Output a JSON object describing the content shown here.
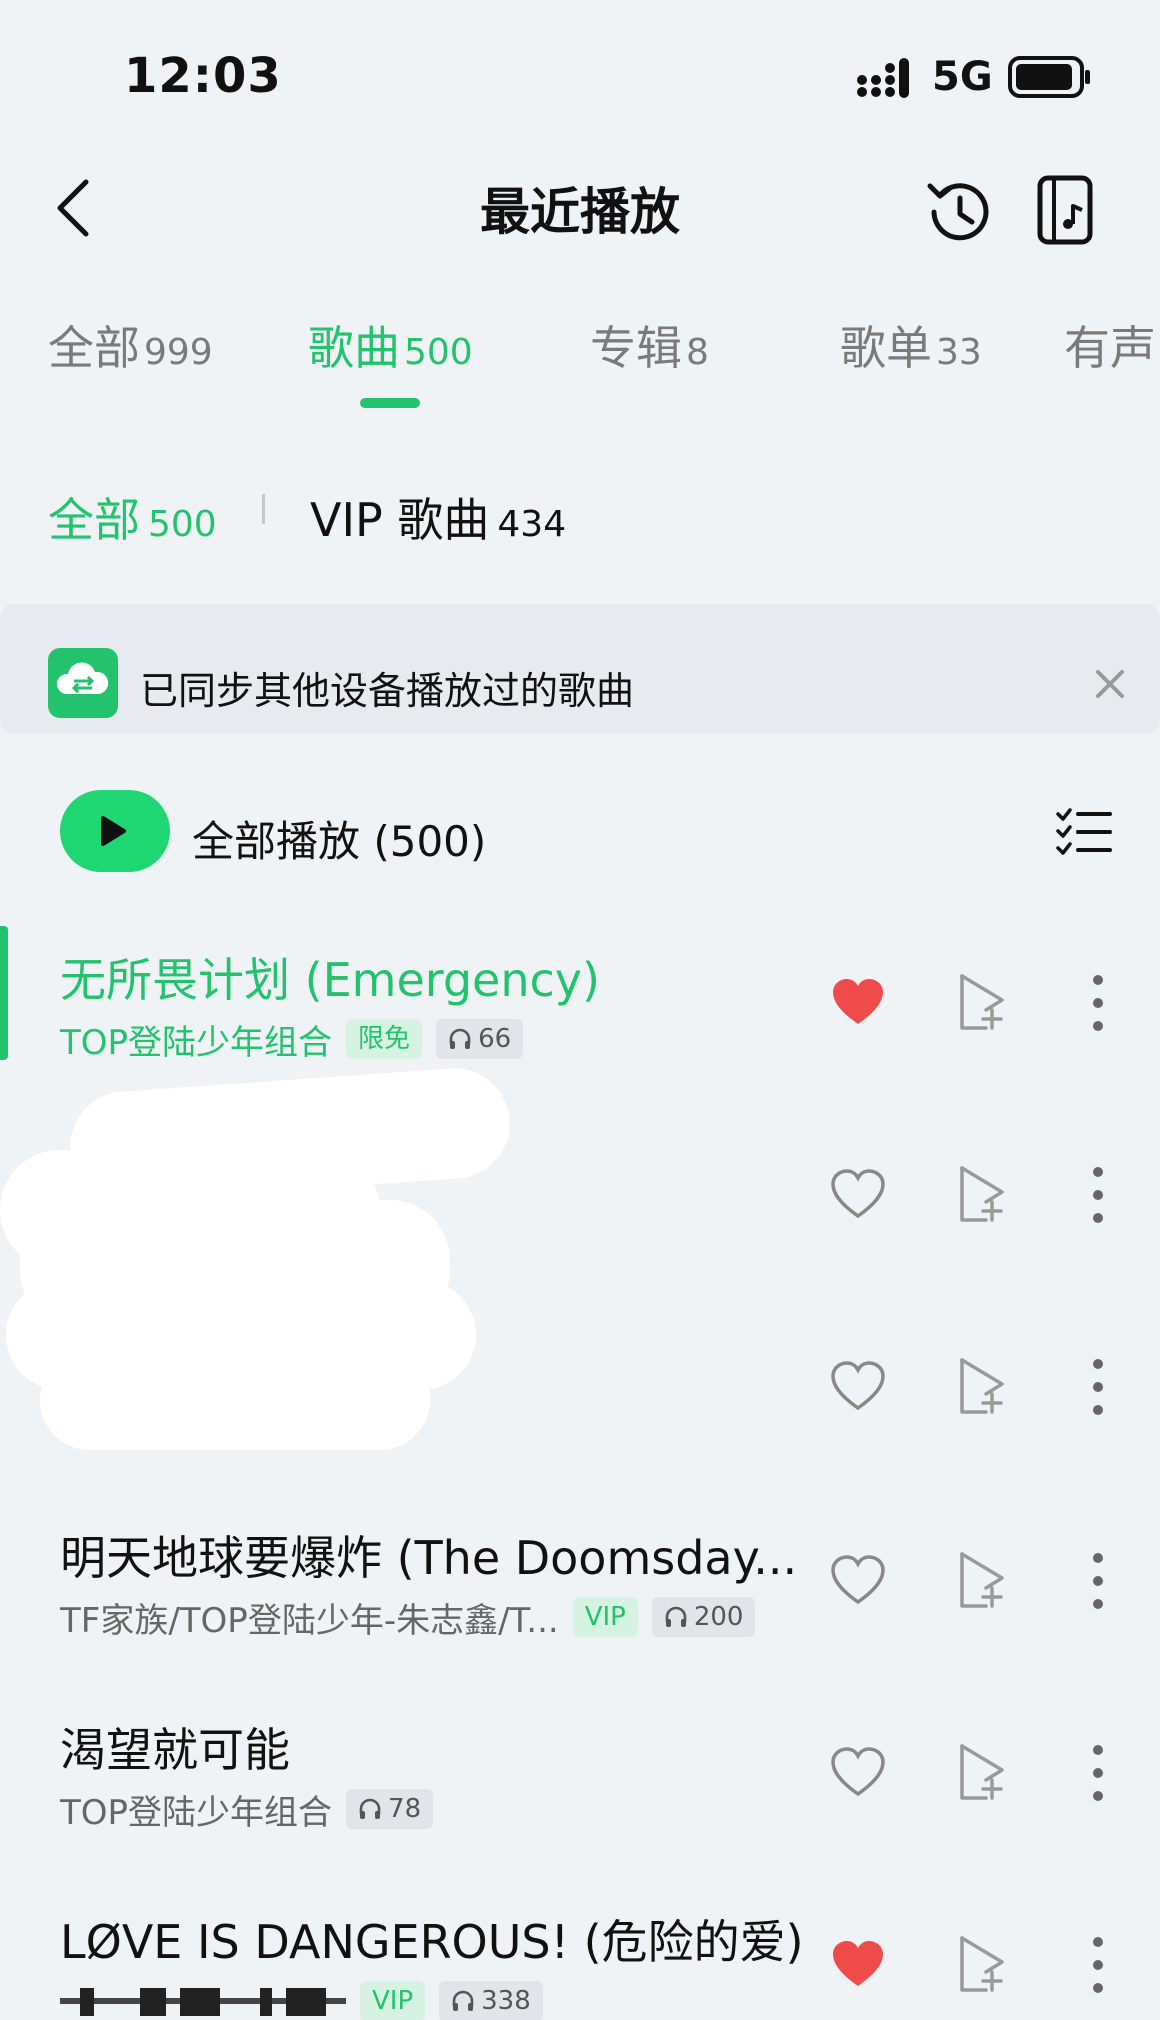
{
  "status_bar": {
    "time": "12:03",
    "network": "5G"
  },
  "header": {
    "title": "最近播放"
  },
  "tabs": [
    {
      "label": "全部",
      "count": "999"
    },
    {
      "label": "歌曲",
      "count": "500"
    },
    {
      "label": "专辑",
      "count": "8"
    },
    {
      "label": "歌单",
      "count": "33"
    },
    {
      "label": "有声",
      "count": ""
    }
  ],
  "filters": {
    "all": {
      "label": "全部",
      "count": "500"
    },
    "vip": {
      "label": "VIP 歌曲",
      "count": "434"
    }
  },
  "sync_banner": {
    "text": "已同步其他设备播放过的歌曲"
  },
  "play_all": {
    "label": "全部播放 (500)"
  },
  "colors": {
    "accent": "#22c36c",
    "heart_red": "#f04b4b",
    "background": "#f0f3f6"
  },
  "songs": [
    {
      "title": "无所畏计划 (Emergency)",
      "artist": "TOP登陆少年组合",
      "tag": "限免",
      "plays": "66",
      "liked": true,
      "playing": true
    },
    {
      "title": "",
      "artist": "",
      "tag": "",
      "plays": "",
      "liked": false,
      "playing": false
    },
    {
      "title": "",
      "artist": "",
      "tag": "",
      "plays": "",
      "liked": false,
      "playing": false
    },
    {
      "title": "明天地球要爆炸 (The Doomsday...",
      "artist": "TF家族/TOP登陆少年-朱志鑫/T...",
      "tag": "VIP",
      "plays": "200",
      "liked": false,
      "playing": false
    },
    {
      "title": "渴望就可能",
      "artist": "TOP登陆少年组合",
      "tag": "",
      "plays": "78",
      "liked": false,
      "playing": false
    },
    {
      "title": "LØVE IS DANGEROUS! (危险的爱)",
      "artist": "",
      "tag": "VIP",
      "plays": "338",
      "liked": true,
      "playing": false
    }
  ]
}
